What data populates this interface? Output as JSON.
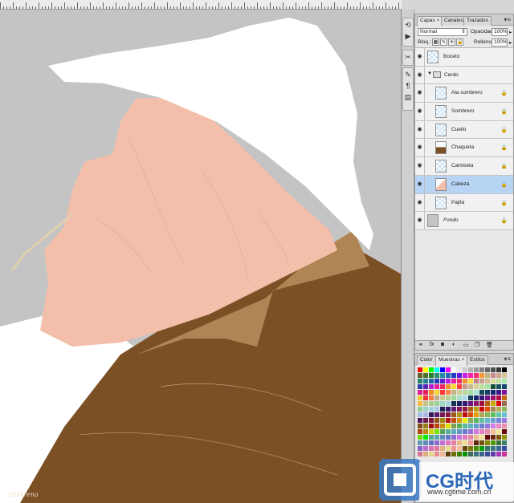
{
  "ruler": {
    "numbers": [
      "|",
      "|",
      "|",
      "|",
      "|",
      "|",
      "|",
      "|",
      "|",
      "|",
      "|",
      "|",
      "|",
      "|",
      "|",
      "|",
      "|",
      "|",
      "|",
      "|",
      "|",
      "|",
      "|",
      "|",
      "|",
      "|",
      "|",
      "|",
      "|",
      "|",
      "|",
      "|"
    ]
  },
  "canvas": {
    "watermark": "CGArena",
    "colors": {
      "background": "#c4c4c4",
      "skin": "#f3bfaa",
      "hat": "#ffffff",
      "jacket": "#7c5025",
      "collar": "#b08555",
      "shirt": "#ffffff",
      "straw": "#e0d0b0"
    }
  },
  "layers_panel": {
    "tabs": [
      {
        "label": "Capas",
        "close": "×"
      },
      {
        "label": "Canales",
        "close": ""
      },
      {
        "label": "Trazados",
        "close": ""
      }
    ],
    "menu_icon": "▾≡",
    "blend_mode": "Normal",
    "opacity_label": "Opacidad:",
    "opacity_value": "100%",
    "lock_label": "Bloq.:",
    "fill_label": "Relleno:",
    "fill_value": "100%",
    "layers": [
      {
        "name": "Boceto",
        "visible": true,
        "indent": false,
        "locked": false,
        "selected": false,
        "thumb": "sketch"
      },
      {
        "name": "Cerdo",
        "visible": true,
        "indent": false,
        "locked": false,
        "selected": false,
        "thumb": "group"
      },
      {
        "name": "Ala sombrero",
        "visible": true,
        "indent": true,
        "locked": true,
        "selected": false,
        "thumb": "hatbrim"
      },
      {
        "name": "Sombrero",
        "visible": true,
        "indent": true,
        "locked": true,
        "selected": false,
        "thumb": "hat"
      },
      {
        "name": "Cuello",
        "visible": true,
        "indent": true,
        "locked": true,
        "selected": false,
        "thumb": "neck"
      },
      {
        "name": "Chaqueta",
        "visible": true,
        "indent": true,
        "locked": true,
        "selected": false,
        "thumb": "jacket"
      },
      {
        "name": "Camiseta",
        "visible": true,
        "indent": true,
        "locked": true,
        "selected": false,
        "thumb": "shirt"
      },
      {
        "name": "Cabeza",
        "visible": true,
        "indent": true,
        "locked": true,
        "selected": true,
        "thumb": "head"
      },
      {
        "name": "Pajita",
        "visible": true,
        "indent": true,
        "locked": true,
        "selected": false,
        "thumb": "straw"
      },
      {
        "name": "Fondo",
        "visible": true,
        "indent": false,
        "locked": true,
        "selected": false,
        "thumb": "bg"
      }
    ],
    "footer_icons": [
      "link-icon",
      "fx-icon",
      "mask-icon",
      "adjustment-icon",
      "group-icon",
      "new-layer-icon",
      "trash-icon"
    ]
  },
  "swatches_panel": {
    "tabs": [
      {
        "label": "Color",
        "close": ""
      },
      {
        "label": "Muestras",
        "close": "×"
      },
      {
        "label": "Estilos",
        "close": ""
      }
    ],
    "menu_icon": "▾≡"
  },
  "branding": {
    "logo_text": "CG时代",
    "url": "www.cgtime.com.cn"
  }
}
